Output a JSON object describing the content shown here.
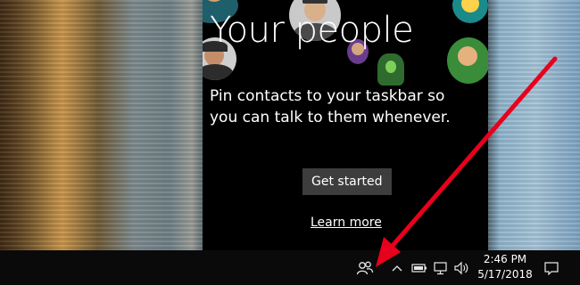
{
  "panel": {
    "title": "Your people",
    "description": "Pin contacts to your taskbar so you can talk to them whenever.",
    "primary_button": "Get started",
    "link": "Learn more"
  },
  "taskbar": {
    "time": "2:46 PM",
    "date": "5/17/2018",
    "icons": [
      "people-icon",
      "chevron-up-icon",
      "battery-icon",
      "network-icon",
      "volume-icon",
      "action-center-icon"
    ]
  },
  "colors": {
    "panel_bg": "#000000",
    "taskbar_bg": "#0a0a0a",
    "button_bg": "#3d3d3d",
    "arrow": "#e8001c"
  }
}
